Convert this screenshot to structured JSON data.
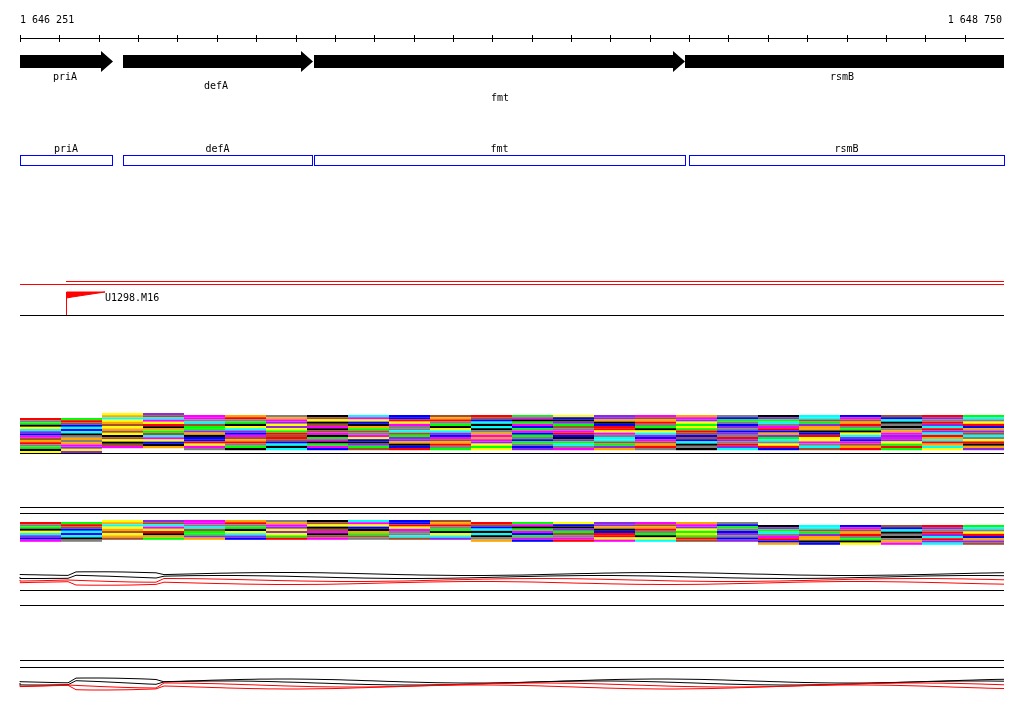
{
  "ruler": {
    "start": "1 646 251",
    "end": "1 648 750"
  },
  "genes": [
    {
      "label": "priA"
    },
    {
      "label": "defA"
    },
    {
      "label": "fmt"
    },
    {
      "label": "rsmB"
    }
  ],
  "gene_boxes": [
    {
      "label": "priA"
    },
    {
      "label": "defA"
    },
    {
      "label": "fmt"
    },
    {
      "label": "rsmB"
    }
  ],
  "feature": {
    "label": "U1298.M16"
  }
}
